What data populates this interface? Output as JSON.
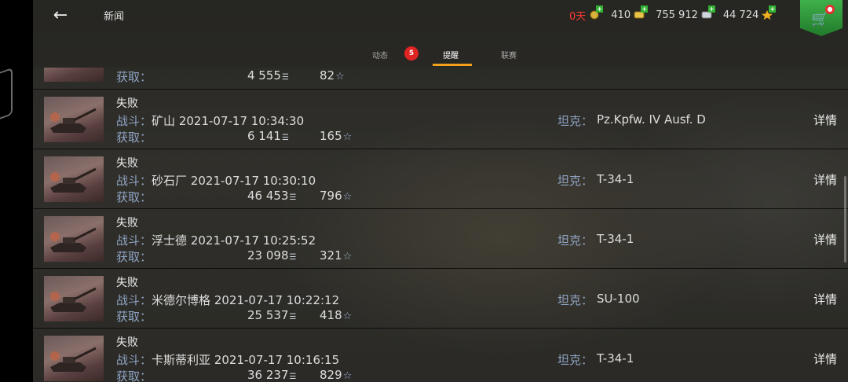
{
  "header": {
    "back_icon": "arrow-left-icon",
    "title": "新闻",
    "currencies": [
      {
        "value": "0天",
        "icon": "premium-days-icon",
        "color": "#ff3b30"
      },
      {
        "value": "410",
        "icon": "gold-icon",
        "color": "#e6c24a"
      },
      {
        "value": "755 912",
        "icon": "silver-icon",
        "color": "#cfd6de"
      },
      {
        "value": "44 724",
        "icon": "free-exp-star-icon",
        "color": "#f0b020"
      }
    ],
    "shop_icon": "shop-cart-icon"
  },
  "tabs": [
    {
      "label": "动态",
      "badge": "5"
    },
    {
      "label": "提醒",
      "active": true
    },
    {
      "label": "联赛"
    }
  ],
  "labels": {
    "battle": "战斗：",
    "earned": "获取：",
    "tank": "坦克："
  },
  "partial_row": {
    "credits": "4 555",
    "exp": "82"
  },
  "rows": [
    {
      "result": "失败",
      "map": "矿山",
      "datetime": "2021-07-17 10:34:30",
      "credits": "6 141",
      "exp": "165",
      "tank": "Pz.Kpfw. IV Ausf. D",
      "details": "详情"
    },
    {
      "result": "失败",
      "map": "砂石厂",
      "datetime": "2021-07-17 10:30:10",
      "credits": "46 453",
      "exp": "796",
      "tank": "T-34-1",
      "details": "详情"
    },
    {
      "result": "失败",
      "map": "浮士德",
      "datetime": "2021-07-17 10:25:52",
      "credits": "23 098",
      "exp": "321",
      "tank": "T-34-1",
      "details": "详情"
    },
    {
      "result": "失败",
      "map": "米德尔博格",
      "datetime": "2021-07-17 10:22:12",
      "credits": "25 537",
      "exp": "418",
      "tank": "SU-100",
      "details": "详情"
    },
    {
      "result": "失败",
      "map": "卡斯蒂利亚",
      "datetime": "2021-07-17 10:16:15",
      "credits": "36 237",
      "exp": "829",
      "tank": "T-34-1",
      "details": "详情"
    }
  ],
  "colors": {
    "accent_tab": "#f2a21a",
    "label_blue": "#8fa4c4",
    "badge_red": "#e02424"
  }
}
